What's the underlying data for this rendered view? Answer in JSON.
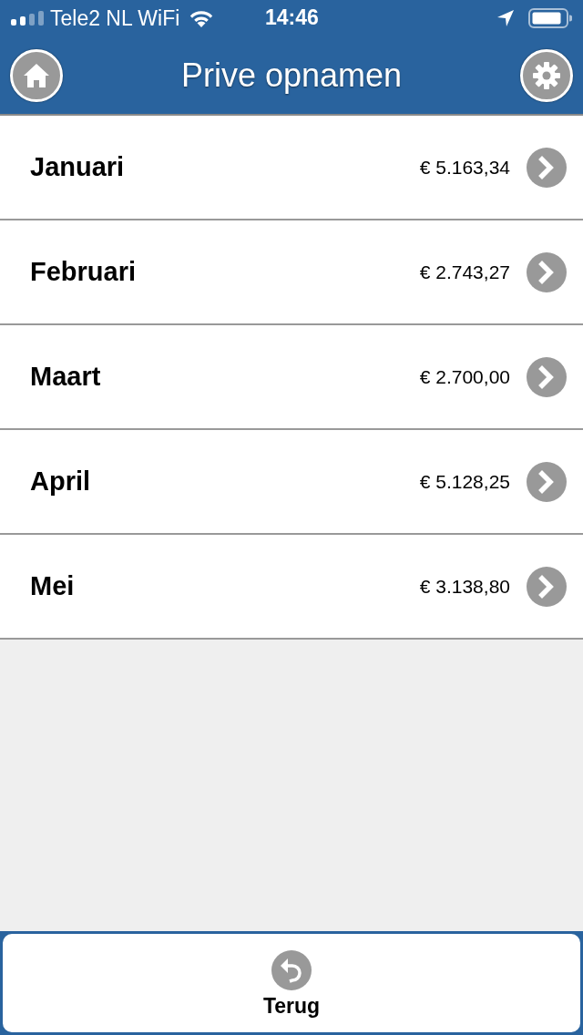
{
  "status_bar": {
    "carrier": "Tele2 NL WiFi",
    "time": "14:46"
  },
  "header": {
    "title": "Prive opnamen"
  },
  "months": [
    {
      "name": "Januari",
      "amount": "€ 5.163,34"
    },
    {
      "name": "Februari",
      "amount": "€ 2.743,27"
    },
    {
      "name": "Maart",
      "amount": "€ 2.700,00"
    },
    {
      "name": "April",
      "amount": "€ 5.128,25"
    },
    {
      "name": "Mei",
      "amount": "€ 3.138,80"
    }
  ],
  "footer": {
    "back_button": "Terug"
  }
}
